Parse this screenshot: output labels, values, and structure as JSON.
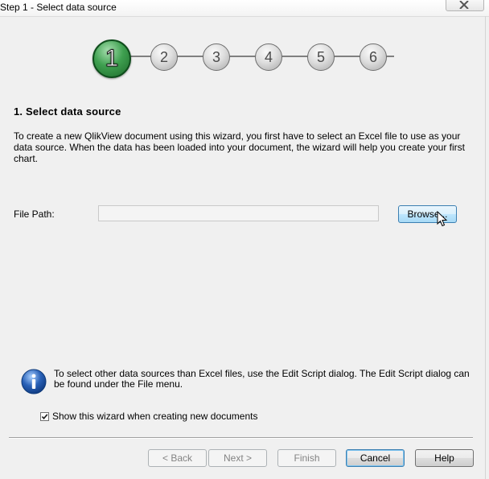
{
  "window": {
    "title": "Step 1 - Select data source"
  },
  "steps": {
    "items": [
      "1",
      "2",
      "3",
      "4",
      "5",
      "6"
    ],
    "active": "1"
  },
  "heading": "1. Select data source",
  "description": "To create a new QlikView document using this wizard, you first have to select an Excel file to use as your data source. When the data has been loaded into your document, the wizard will help you create your first chart.",
  "file_path": {
    "label": "File Path:",
    "value": "",
    "browse_label": "Browse..."
  },
  "info": {
    "icon": "info-icon",
    "text": "To select other data sources than Excel files, use the Edit Script dialog. The Edit Script dialog can be found under the File menu."
  },
  "show_wizard": {
    "label": "Show this wizard when creating new documents",
    "checked": true
  },
  "buttons": {
    "back": "< Back",
    "next": "Next >",
    "finish": "Finish",
    "cancel": "Cancel",
    "help": "Help"
  },
  "colors": {
    "active_step": "#3fa050",
    "dialog_bg": "#f0f0f0",
    "info_icon": "#2a62b8"
  }
}
